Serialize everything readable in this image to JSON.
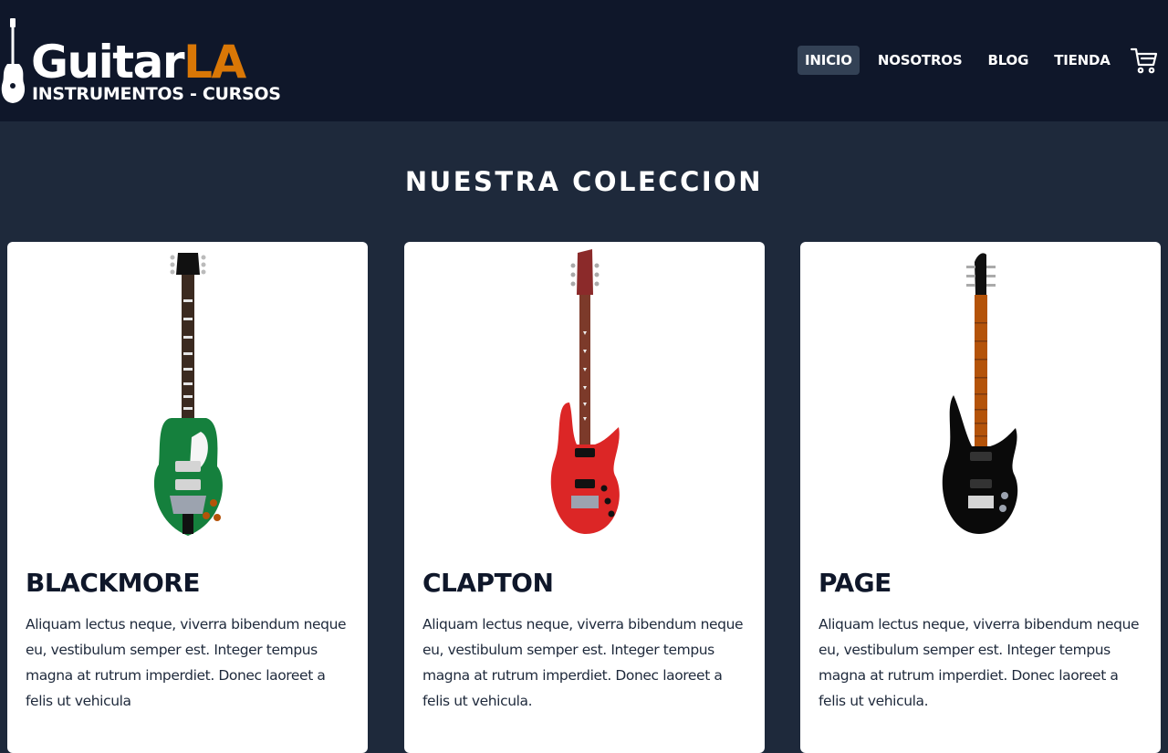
{
  "header": {
    "logo": {
      "main": "Guitar",
      "accent": "LA",
      "sub": "INSTRUMENTOS - CURSOS",
      "icon": "guitar-icon"
    },
    "nav": [
      {
        "label": "INICIO",
        "active": true
      },
      {
        "label": "NOSOTROS",
        "active": false
      },
      {
        "label": "BLOG",
        "active": false
      },
      {
        "label": "TIENDA",
        "active": false
      }
    ],
    "cart_icon": "cart-icon"
  },
  "section": {
    "title": "NUESTRA COLECCION"
  },
  "products": [
    {
      "name": "BLACKMORE",
      "description": "Aliquam lectus neque, viverra bibendum neque eu, vestibulum semper est. Integer tempus magna at rutrum imperdiet. Donec laoreet a felis ut vehicula",
      "image": "green-les-paul-guitar",
      "body_color": "#15803d"
    },
    {
      "name": "CLAPTON",
      "description": "Aliquam lectus neque, viverra bibendum neque eu, vestibulum semper est. Integer tempus magna at rutrum imperdiet. Donec laoreet a felis ut vehicula.",
      "image": "red-superstrat-guitar",
      "body_color": "#dc2626"
    },
    {
      "name": "PAGE",
      "description": "Aliquam lectus neque, viverra bibendum neque eu, vestibulum semper est. Integer tempus magna at rutrum imperdiet. Donec laoreet a felis ut vehicula.",
      "image": "black-superstrat-guitar",
      "body_color": "#0a0a0a"
    }
  ],
  "colors": {
    "header_bg": "#0f172a",
    "page_bg": "#1e293b",
    "accent": "#d97706",
    "card_bg": "#ffffff"
  }
}
